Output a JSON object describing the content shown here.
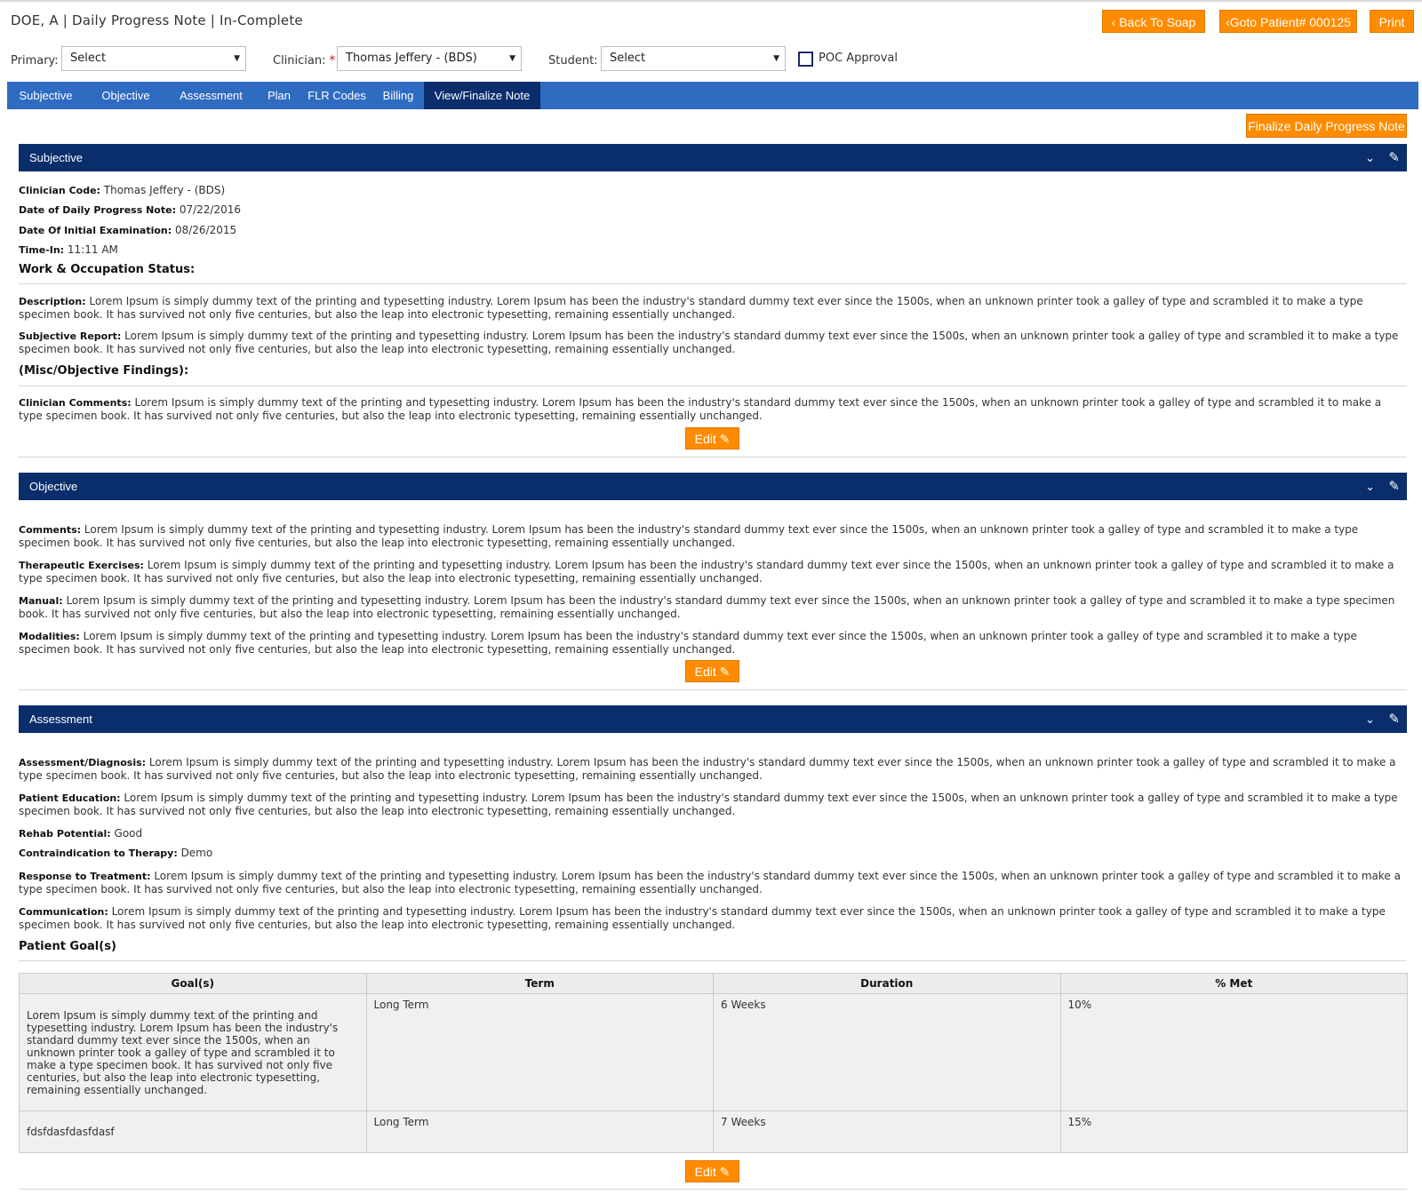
{
  "header": {
    "title": "DOE, A | Daily Progress Note | In-Complete",
    "back_label": "Back To Soap",
    "goto_label": "Goto Patient# 000125",
    "print_label": "Print"
  },
  "filters": {
    "primary_label": "Primary:",
    "primary_value": "Select",
    "clinician_label": "Clinician:",
    "clinician_required": "*",
    "clinician_value": "Thomas Jeffery - (BDS)",
    "student_label": "Student:",
    "student_value": "Select",
    "poc_label": "POC Approval"
  },
  "tabs": [
    {
      "label": "Subjective"
    },
    {
      "label": "Objective"
    },
    {
      "label": "Assessment"
    },
    {
      "label": "Plan"
    },
    {
      "label": "FLR Codes"
    },
    {
      "label": "Billing"
    },
    {
      "label": "View/Finalize Note"
    }
  ],
  "finalize_label": "Finalize Daily Progress Note",
  "edit_label": "Edit",
  "subjective": {
    "title": "Subjective",
    "clinician_code_label": "Clinician Code:",
    "clinician_code_value": "Thomas Jeffery - (BDS)",
    "date_note_label": "Date of Daily Progress Note:",
    "date_note_value": "07/22/2016",
    "date_exam_label": "Date Of Initial Examination:",
    "date_exam_value": "08/26/2015",
    "time_in_label": "Time-In:",
    "time_in_value": "11:11 AM",
    "work_heading": "Work & Occupation Status:",
    "description_label": "Description:",
    "description_text": "Lorem Ipsum is simply dummy text of the printing and typesetting industry. Lorem Ipsum has been the industry's standard dummy text ever since the 1500s, when an unknown printer took a galley of type and scrambled it to make a type specimen book. It has survived not only five centuries, but also the leap into electronic typesetting, remaining essentially unchanged.",
    "report_label": "Subjective Report:",
    "report_text": "Lorem Ipsum is simply dummy text of the printing and typesetting industry. Lorem Ipsum has been the industry's standard dummy text ever since the 1500s, when an unknown printer took a galley of type and scrambled it to make a type specimen book. It has survived not only five centuries, but also the leap into electronic typesetting, remaining essentially unchanged.",
    "misc_heading": "(Misc/Objective Findings):",
    "comments_label": "Clinician Comments:",
    "comments_text": "Lorem Ipsum is simply dummy text of the printing and typesetting industry. Lorem Ipsum has been the industry's standard dummy text ever since the 1500s, when an unknown printer took a galley of type and scrambled it to make a type specimen book. It has survived not only five centuries, but also the leap into electronic typesetting, remaining essentially unchanged."
  },
  "objective": {
    "title": "Objective",
    "comments_label": "Comments:",
    "comments_text": "Lorem Ipsum is simply dummy text of the printing and typesetting industry. Lorem Ipsum has been the industry's standard dummy text ever since the 1500s, when an unknown printer took a galley of type and scrambled it to make a type specimen book. It has survived not only five centuries, but also the leap into electronic typesetting, remaining essentially unchanged.",
    "exercises_label": "Therapeutic Exercises:",
    "exercises_text": "Lorem Ipsum is simply dummy text of the printing and typesetting industry. Lorem Ipsum has been the industry's standard dummy text ever since the 1500s, when an unknown printer took a galley of type and scrambled it to make a type specimen book. It has survived not only five centuries, but also the leap into electronic typesetting, remaining essentially unchanged.",
    "manual_label": "Manual:",
    "manual_text": "Lorem Ipsum is simply dummy text of the printing and typesetting industry. Lorem Ipsum has been the industry's standard dummy text ever since the 1500s, when an unknown printer took a galley of type and scrambled it to make a type specimen book. It has survived not only five centuries, but also the leap into electronic typesetting, remaining essentially unchanged.",
    "modalities_label": "Modalities:",
    "modalities_text": "Lorem Ipsum is simply dummy text of the printing and typesetting industry. Lorem Ipsum has been the industry's standard dummy text ever since the 1500s, when an unknown printer took a galley of type and scrambled it to make a type specimen book. It has survived not only five centuries, but also the leap into electronic typesetting, remaining essentially unchanged."
  },
  "assessment": {
    "title": "Assessment",
    "diagnosis_label": "Assessment/Diagnosis:",
    "diagnosis_text": "Lorem Ipsum is simply dummy text of the printing and typesetting industry. Lorem Ipsum has been the industry's standard dummy text ever since the 1500s, when an unknown printer took a galley of type and scrambled it to make a type specimen book. It has survived not only five centuries, but also the leap into electronic typesetting, remaining essentially unchanged.",
    "education_label": "Patient Education:",
    "education_text": "Lorem Ipsum is simply dummy text of the printing and typesetting industry. Lorem Ipsum has been the industry's standard dummy text ever since the 1500s, when an unknown printer took a galley of type and scrambled it to make a type specimen book. It has survived not only five centuries, but also the leap into electronic typesetting, remaining essentially unchanged.",
    "rehab_label": "Rehab Potential:",
    "rehab_value": "Good",
    "contra_label": "Contraindication to Therapy:",
    "contra_value": "Demo",
    "response_label": "Response to Treatment:",
    "response_text": "Lorem Ipsum is simply dummy text of the printing and typesetting industry. Lorem Ipsum has been the industry's standard dummy text ever since the 1500s, when an unknown printer took a galley of type and scrambled it to make a type specimen book. It has survived not only five centuries, but also the leap into electronic typesetting, remaining essentially unchanged.",
    "communication_label": "Communication:",
    "communication_text": "Lorem Ipsum is simply dummy text of the printing and typesetting industry. Lorem Ipsum has been the industry's standard dummy text ever since the 1500s, when an unknown printer took a galley of type and scrambled it to make a type specimen book. It has survived not only five centuries, but also the leap into electronic typesetting, remaining essentially unchanged.",
    "goals_heading": "Patient Goal(s)",
    "goals_columns": [
      "Goal(s)",
      "Term",
      "Duration",
      "% Met"
    ],
    "goals_rows": [
      {
        "goal": "Lorem Ipsum is simply dummy text of the printing and typesetting industry. Lorem Ipsum has been the industry's standard dummy text ever since the 1500s, when an unknown printer took a galley of type and scrambled it to make a type specimen book. It has survived not only five centuries, but also the leap into electronic typesetting, remaining essentially unchanged.",
        "term": "Long Term",
        "duration": "6 Weeks",
        "met": "10%"
      },
      {
        "goal": "fdsfdasfdasfdasf",
        "term": "Long Term",
        "duration": "7 Weeks",
        "met": "15%"
      }
    ]
  },
  "colors": {
    "accent_orange": "#ff8c00",
    "tab_bar": "#2f6bc1",
    "section_header": "#0a2d6b"
  }
}
